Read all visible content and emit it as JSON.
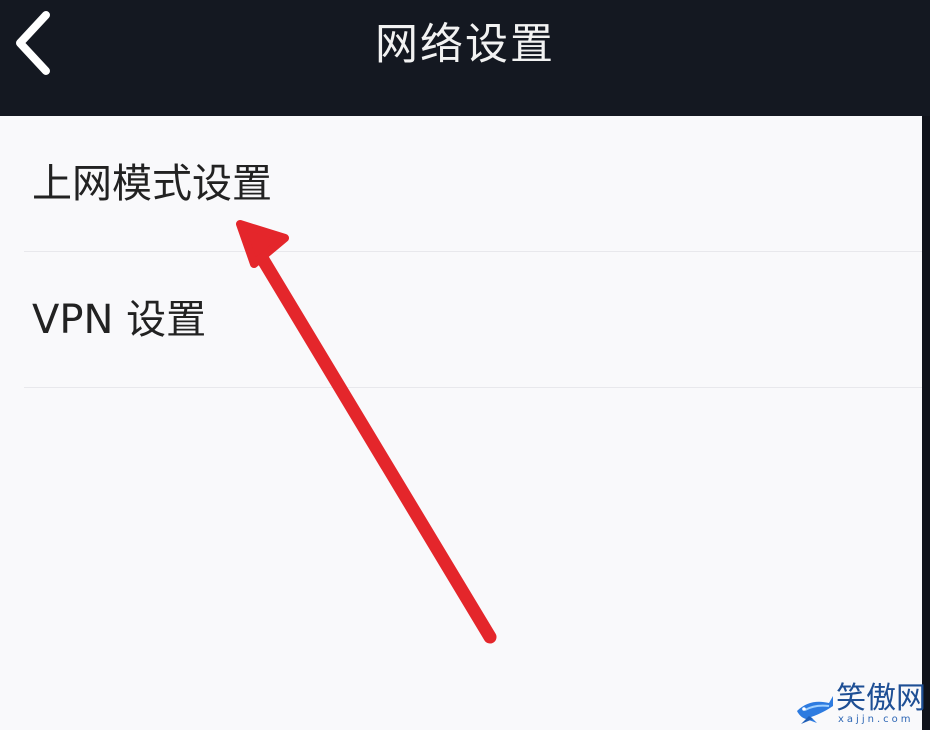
{
  "header": {
    "title": "网络设置",
    "back_icon": "chevron-left-icon"
  },
  "menu": {
    "items": [
      {
        "label": "上网模式设置"
      },
      {
        "label": "VPN 设置"
      }
    ]
  },
  "annotation": {
    "arrow_color": "#e4262b"
  },
  "watermark": {
    "brand": "笑傲网",
    "domain": "xajjn.com",
    "icon": "shark-icon"
  },
  "colors": {
    "header_background": "#141821",
    "page_background": "#f9f9fb",
    "text": "#222222",
    "watermark_blue": "#1e4f95"
  }
}
